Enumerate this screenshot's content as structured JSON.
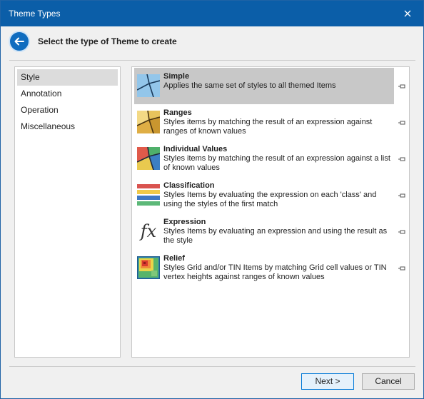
{
  "window": {
    "title": "Theme Types"
  },
  "header": {
    "text": "Select the type of Theme to create"
  },
  "categories": [
    {
      "label": "Style"
    },
    {
      "label": "Annotation"
    },
    {
      "label": "Operation"
    },
    {
      "label": "Miscellaneous"
    }
  ],
  "themes": [
    {
      "name": "Simple",
      "description": "Applies the same set of styles to all themed Items",
      "icon": "simple-theme-icon"
    },
    {
      "name": "Ranges",
      "description": "Styles items by matching the result of an expression against ranges of known values",
      "icon": "ranges-theme-icon"
    },
    {
      "name": "Individual Values",
      "description": "Styles items by matching the result of an expression against a list of known values",
      "icon": "individual-values-theme-icon"
    },
    {
      "name": "Classification",
      "description": "Styles Items by evaluating the expression on each 'class' and using the styles of the first match",
      "icon": "classification-theme-icon"
    },
    {
      "name": "Expression",
      "description": "Styles Items by evaluating an expression and using the result as the style",
      "icon": "expression-theme-icon",
      "glyph": "fx"
    },
    {
      "name": "Relief",
      "description": "Styles Grid and/or TIN Items by matching Grid cell values or TIN vertex heights against ranges of known values",
      "icon": "relief-theme-icon"
    }
  ],
  "buttons": {
    "next": "Next >",
    "cancel": "Cancel"
  },
  "colors": {
    "titlebar": "#0b5ea8",
    "accent": "#0f6cbf",
    "selection": "#c8c8c8"
  }
}
